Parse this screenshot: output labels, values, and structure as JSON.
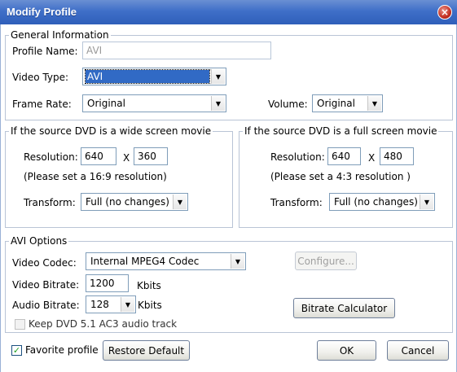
{
  "window": {
    "title": "Modify Profile",
    "close_glyph": "×"
  },
  "general": {
    "legend": "General Information",
    "profile_name_label": "Profile Name:",
    "profile_name_value": "AVI",
    "video_type_label": "Video Type:",
    "video_type_value": "AVI",
    "frame_rate_label": "Frame Rate:",
    "frame_rate_value": "Original",
    "volume_label": "Volume:",
    "volume_value": "Original"
  },
  "wide": {
    "legend": "If the source DVD is a wide screen movie",
    "resolution_label": "Resolution:",
    "width": "640",
    "x_sep": "X",
    "height": "360",
    "hint": "(Please set a 16:9 resolution)",
    "transform_label": "Transform:",
    "transform_value": "Full (no changes)"
  },
  "full": {
    "legend": "If the source DVD is a full screen movie",
    "resolution_label": "Resolution:",
    "width": "640",
    "x_sep": "X",
    "height": "480",
    "hint": "(Please set a 4:3 resolution )",
    "transform_label": "Transform:",
    "transform_value": "Full (no changes)"
  },
  "avi": {
    "legend": "AVI Options",
    "video_codec_label": "Video Codec:",
    "video_codec_value": "Internal MPEG4 Codec",
    "configure_label": "Configure...",
    "video_bitrate_label": "Video Bitrate:",
    "video_bitrate_value": "1200",
    "video_bitrate_unit": "Kbits",
    "audio_bitrate_label": "Audio Bitrate:",
    "audio_bitrate_value": "128",
    "audio_bitrate_unit": "Kbits",
    "bitrate_calc_label": "Bitrate Calculator",
    "keep_ac3_label": "Keep DVD 5.1 AC3 audio track",
    "keep_ac3_checked": false
  },
  "footer": {
    "favorite_label": "Favorite profile",
    "favorite_checked": true,
    "restore_label": "Restore Default",
    "ok_label": "OK",
    "cancel_label": "Cancel",
    "check_glyph": "✓"
  },
  "icons": {
    "dropdown_arrow": "▼"
  },
  "colors": {
    "titlebar": "#3f6fc8",
    "selection": "#316ac5",
    "close": "#c42f22"
  }
}
